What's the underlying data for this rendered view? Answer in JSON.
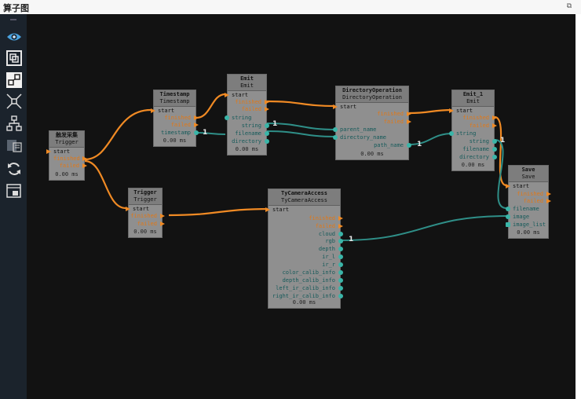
{
  "window": {
    "title": "算子图"
  },
  "toolbar": {
    "tools": [
      "eye-icon",
      "layers-icon",
      "node-link-icon",
      "collapse-icon",
      "tree-icon",
      "grid-export-icon",
      "refresh-icon",
      "subgraph-icon"
    ]
  },
  "colors": {
    "exec": "#f08a24",
    "data": "#2f8f88",
    "canvas": "#121212",
    "node": "#8f8f8f"
  },
  "nodes": {
    "trigger_collect": {
      "title": "触发采集",
      "type": "Trigger",
      "ports": [
        "start",
        "finished",
        "failed"
      ],
      "time": "0.00 ms"
    },
    "timestamp": {
      "title": "Timestamp",
      "type": "Timestamp",
      "ports": [
        "start",
        "finished",
        "failed",
        "timestamp"
      ],
      "time": "0.00 ms"
    },
    "emit": {
      "title": "Emit",
      "type": "Emit",
      "ports": [
        "start",
        "finished",
        "failed",
        "string",
        "string",
        "filename",
        "directory"
      ],
      "time": "0.00 ms"
    },
    "dir_op": {
      "title": "DirectoryOperation",
      "type": "DirectoryOperation",
      "ports": [
        "start",
        "finished",
        "failed",
        "parent_name",
        "directory_name",
        "path_name"
      ],
      "time": "0.00 ms"
    },
    "emit1": {
      "title": "Emit_1",
      "type": "Emit",
      "ports": [
        "start",
        "finished",
        "failed",
        "string",
        "string",
        "filename",
        "directory"
      ],
      "time": "0.00 ms"
    },
    "trigger": {
      "title": "Trigger",
      "type": "Trigger",
      "ports": [
        "start",
        "finished",
        "failed"
      ],
      "time": "0.00 ms"
    },
    "tycam": {
      "title": "TyCameraAccess",
      "type": "TyCameraAccess",
      "ports": [
        "start",
        "finished",
        "failed",
        "cloud",
        "rgb",
        "depth",
        "ir_l",
        "ir_r",
        "color_calib_info",
        "depth_calib_info",
        "left_ir_calib_info",
        "right_ir_calib_info"
      ],
      "time": "0.00 ms"
    },
    "save": {
      "title": "Save",
      "type": "Save",
      "ports": [
        "start",
        "finished",
        "failed",
        "filename",
        "image",
        "image_list"
      ],
      "time": "0.00 ms"
    }
  },
  "connection_labels": [
    "1",
    "1",
    "1",
    "1",
    "1"
  ]
}
